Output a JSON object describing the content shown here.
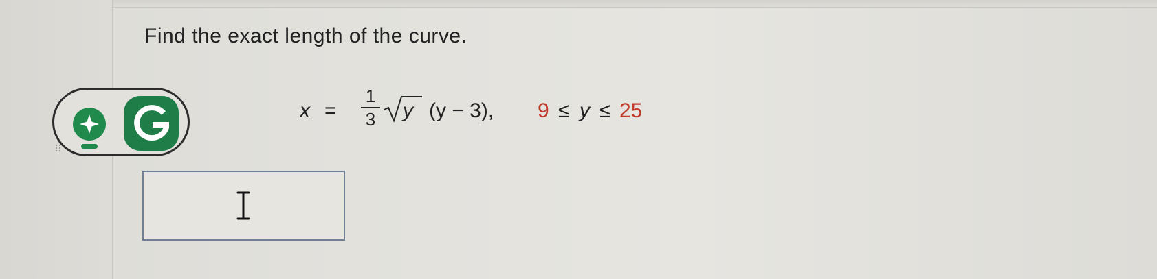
{
  "question": {
    "text": "Find the exact length of the curve."
  },
  "equation": {
    "lhs_var": "x",
    "equals": "=",
    "frac_num": "1",
    "frac_den": "3",
    "radicand": "y",
    "factor": "(y − 3),",
    "range_left": "9",
    "le1": "≤",
    "range_var": "y",
    "le2": "≤",
    "range_right": "25"
  },
  "answer": {
    "value": ""
  },
  "tools": {
    "hint_icon": "lightbulb-sparkle-icon",
    "g_icon": "g-logo-icon",
    "drag_icon": "drag-handle-icon"
  },
  "colors": {
    "text": "#222222",
    "range_accent": "#c0392b",
    "icon_green": "#1f8a4c",
    "input_border": "#6f7f97"
  }
}
